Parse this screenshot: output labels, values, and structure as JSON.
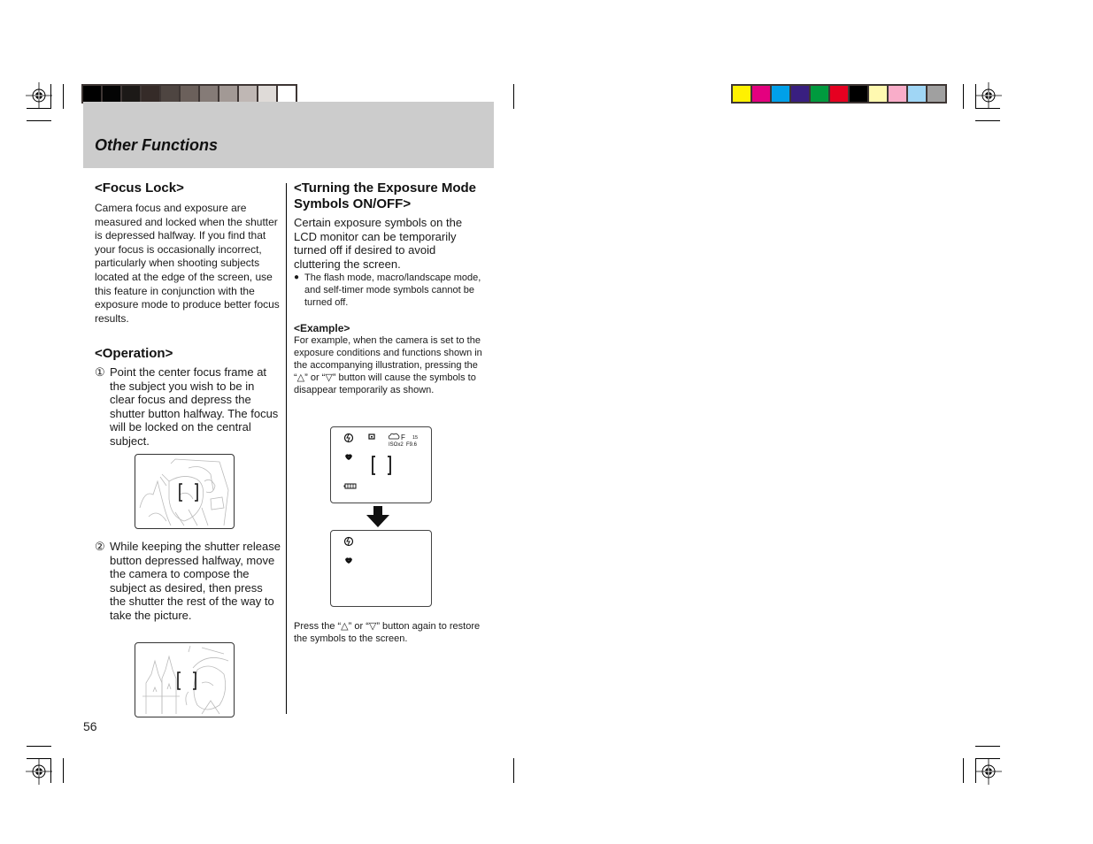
{
  "print_marks": {
    "grayscale_swatches": [
      "#000000",
      "#040404",
      "#1c1917",
      "#352b28",
      "#4e4541",
      "#6b605b",
      "#857b77",
      "#a29995",
      "#bfb7b4",
      "#dfdbd8",
      "#ffffff"
    ],
    "color_swatches": [
      "#fff100",
      "#e4007f",
      "#00a0e9",
      "#391f80",
      "#009a3e",
      "#e60020",
      "#000000",
      "#fff9b0",
      "#f9adc9",
      "#a0d6f5",
      "#a0a0a0"
    ]
  },
  "header": {
    "section_title": "Other Functions",
    "band_color": "#cccccc"
  },
  "left_column": {
    "focus_lock": {
      "heading": "<Focus Lock>",
      "body": "Camera focus and exposure are measured and locked when the shutter is depressed halfway. If you find that your focus is occasionally incorrect, particularly when shooting subjects located at the edge of the screen, use this feature in conjunction with the exposure mode to produce better focus results."
    },
    "operation": {
      "heading": "<Operation>",
      "steps": [
        {
          "number": "①",
          "text": "Point the center focus frame at the subject you wish to be in clear focus and depress the shutter button halfway. The focus will be locked on the central subject."
        },
        {
          "number": "②",
          "text": "While keeping the shutter release button depressed halfway, move the camera to compose the subject as desired, then press the shutter the rest of the way to take the picture."
        }
      ]
    }
  },
  "right_column": {
    "heading": "<Turning the Exposure Mode Symbols ON/OFF>",
    "intro": "Certain exposure symbols on the LCD monitor can be temporarily turned off if desired to avoid cluttering the screen.",
    "bullet": "The flash mode, macro/landscape mode, and self-timer mode symbols cannot be turned off.",
    "bullet_glyph": "●",
    "example_heading": "<Example>",
    "example_body": "For example, when the camera is set to the exposure conditions and functions shown in the accompanying illustration, pressing the “△” or “▽” button will cause the symbols to disappear temporarily as shown.",
    "lcd_before": {
      "icons": [
        "flash-auto-icon",
        "spot-metering-icon",
        "cloudy-white-balance-icon",
        "macro-icon",
        "battery-icon"
      ],
      "wb_label": "F",
      "shutter": "15",
      "iso": "ISOx2",
      "aperture": "F9.6"
    },
    "lcd_after": {
      "icons": [
        "flash-auto-icon",
        "macro-icon"
      ]
    },
    "footer_note": "Press the “△” or “▽” button again to restore the symbols to the screen."
  },
  "page_number": "56"
}
